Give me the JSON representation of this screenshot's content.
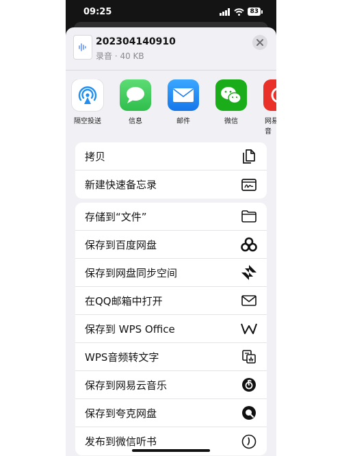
{
  "status_bar": {
    "time": "09:25",
    "battery": "83"
  },
  "file": {
    "name": "202304140910",
    "meta": "录音 · 40 KB"
  },
  "apps": [
    {
      "label": "隔空投送",
      "icon": "airdrop-icon",
      "color": "#ffffff"
    },
    {
      "label": "信息",
      "icon": "messages-icon",
      "color": "#34c759"
    },
    {
      "label": "邮件",
      "icon": "mail-icon",
      "color": "#1e8cf5"
    },
    {
      "label": "微信",
      "icon": "wechat-icon",
      "color": "#1aad19"
    },
    {
      "label": "网易",
      "label2": "音",
      "icon": "netease-music-icon",
      "color": "#e93029"
    }
  ],
  "actions_group1": [
    {
      "label": "拷贝",
      "icon": "copy-icon"
    },
    {
      "label": "新建快速备忘录",
      "icon": "quick-note-icon"
    }
  ],
  "actions_group2": [
    {
      "label": "存储到“文件”",
      "icon": "folder-icon"
    },
    {
      "label": "保存到百度网盘",
      "icon": "baidu-netdisk-icon"
    },
    {
      "label": "保存到网盘同步空间",
      "icon": "sync-space-icon"
    },
    {
      "label": "在QQ邮箱中打开",
      "icon": "envelope-icon"
    },
    {
      "label": "保存到 WPS Office",
      "icon": "wps-icon"
    },
    {
      "label": "WPS音频转文字",
      "icon": "wps-audio-text-icon"
    },
    {
      "label": "保存到网易云音乐",
      "icon": "netease-cloud-icon"
    },
    {
      "label": "保存到夸克网盘",
      "icon": "quark-icon"
    },
    {
      "label": "发布到微信听书",
      "icon": "wechat-listen-icon"
    }
  ]
}
